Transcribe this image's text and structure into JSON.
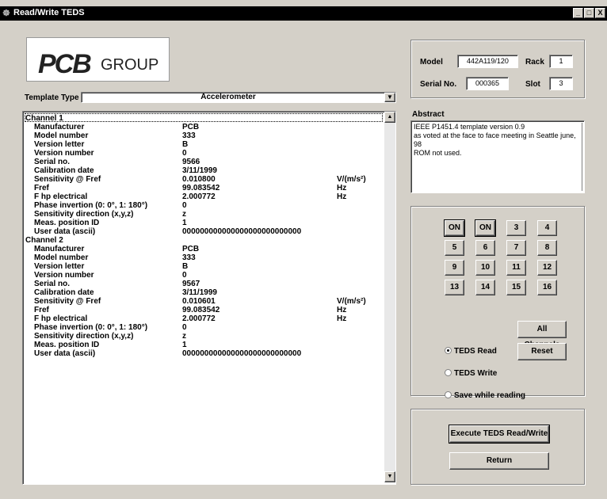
{
  "window": {
    "title": "Read/Write TEDS",
    "controls": [
      "_",
      "□",
      "X"
    ]
  },
  "logo": {
    "mark": "PCB",
    "word": "GROUP"
  },
  "template": {
    "label": "Template Type",
    "value": "Accelerometer"
  },
  "channels": [
    {
      "heading": "Channel 1",
      "rows": [
        {
          "k": "Manufacturer",
          "v": "PCB",
          "u": ""
        },
        {
          "k": "Model number",
          "v": "333",
          "u": ""
        },
        {
          "k": "Version letter",
          "v": "B",
          "u": ""
        },
        {
          "k": "Version number",
          "v": "0",
          "u": ""
        },
        {
          "k": "Serial no.",
          "v": "9566",
          "u": ""
        },
        {
          "k": "Calibration date",
          "v": "3/11/1999",
          "u": ""
        },
        {
          "k": "Sensitivity @ Fref",
          "v": "0.010800",
          "u": "V/(m/s²)"
        },
        {
          "k": "Fref",
          "v": "99.083542",
          "u": "Hz"
        },
        {
          "k": "F hp electrical",
          "v": "2.000772",
          "u": "Hz"
        },
        {
          "k": "Phase invertion (0: 0°, 1: 180°)",
          "v": "0",
          "u": ""
        },
        {
          "k": "Sensitivity direction (x,y,z)",
          "v": "z",
          "u": ""
        },
        {
          "k": "Meas. position ID",
          "v": "1",
          "u": ""
        },
        {
          "k": "User data (ascii)",
          "v": "000000000000000000000000000",
          "u": ""
        }
      ]
    },
    {
      "heading": "Channel 2",
      "rows": [
        {
          "k": "Manufacturer",
          "v": "PCB",
          "u": ""
        },
        {
          "k": "Model number",
          "v": "333",
          "u": ""
        },
        {
          "k": "Version letter",
          "v": "B",
          "u": ""
        },
        {
          "k": "Version number",
          "v": "0",
          "u": ""
        },
        {
          "k": "Serial no.",
          "v": "9567",
          "u": ""
        },
        {
          "k": "Calibration date",
          "v": "3/11/1999",
          "u": ""
        },
        {
          "k": "Sensitivity @ Fref",
          "v": "0.010601",
          "u": "V/(m/s²)"
        },
        {
          "k": "Fref",
          "v": "99.083542",
          "u": "Hz"
        },
        {
          "k": "F hp electrical",
          "v": "2.000772",
          "u": "Hz"
        },
        {
          "k": "Phase invertion (0: 0°, 1: 180°)",
          "v": "0",
          "u": ""
        },
        {
          "k": "Sensitivity direction (x,y,z)",
          "v": "z",
          "u": ""
        },
        {
          "k": "Meas. position ID",
          "v": "1",
          "u": ""
        },
        {
          "k": "User data (ascii)",
          "v": "000000000000000000000000000",
          "u": ""
        }
      ]
    }
  ],
  "device": {
    "model_label": "Model",
    "model_value": "442A119/120",
    "rack_label": "Rack",
    "rack_value": "1",
    "serial_label": "Serial No.",
    "serial_value": "000365",
    "slot_label": "Slot",
    "slot_value": "3"
  },
  "abstract": {
    "label": "Abstract",
    "lines": [
      "IEEE P1451.4 template version 0.9",
      "as voted at the face to face meeting in Seattle june, 98",
      "ROM not used."
    ]
  },
  "channel_buttons": [
    "ON",
    "ON",
    "3",
    "4",
    "5",
    "6",
    "7",
    "8",
    "9",
    "10",
    "11",
    "12",
    "13",
    "14",
    "15",
    "16"
  ],
  "modes": {
    "read": "TEDS Read",
    "write": "TEDS Write",
    "save": "Save while reading",
    "selected": "read"
  },
  "buttons": {
    "all_channels": "All Channels",
    "reset": "Reset",
    "execute": "Execute TEDS Read/Write",
    "return": "Return"
  }
}
